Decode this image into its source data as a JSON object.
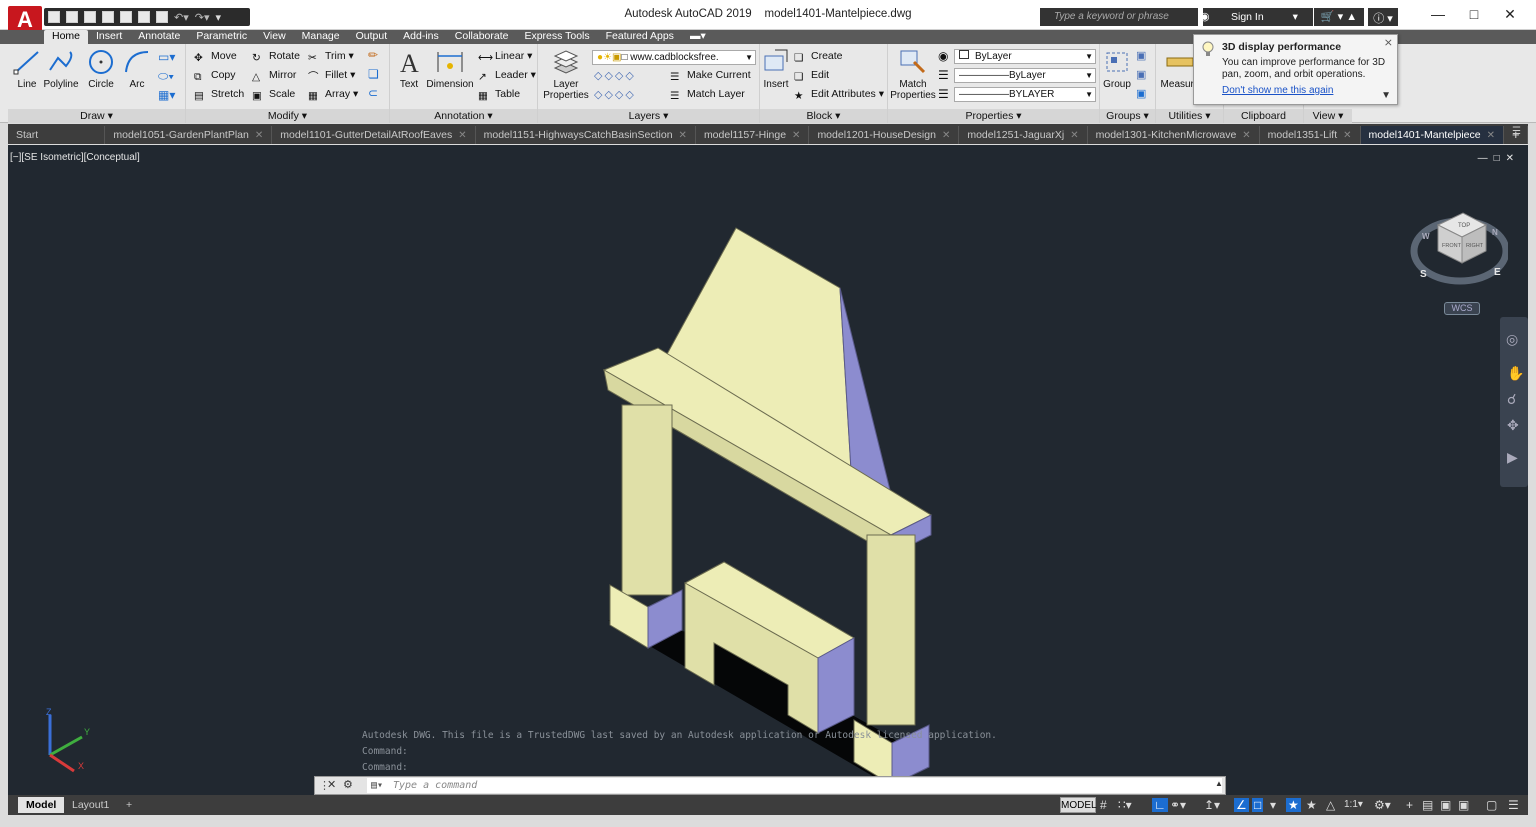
{
  "app": {
    "logo_letter": "A",
    "title": "Autodesk AutoCAD 2019",
    "filename": "model1401-Mantelpiece.dwg"
  },
  "search": {
    "placeholder": "Type a keyword or phrase"
  },
  "signin": {
    "label": "Sign In"
  },
  "ribbon_tabs": [
    "Home",
    "Insert",
    "Annotate",
    "Parametric",
    "View",
    "Manage",
    "Output",
    "Add-ins",
    "Collaborate",
    "Express Tools",
    "Featured Apps"
  ],
  "draw": {
    "line": "Line",
    "polyline": "Polyline",
    "circle": "Circle",
    "arc": "Arc",
    "title": "Draw"
  },
  "modify": {
    "move": "Move",
    "rotate": "Rotate",
    "trim": "Trim",
    "copy": "Copy",
    "mirror": "Mirror",
    "fillet": "Fillet",
    "stretch": "Stretch",
    "scale": "Scale",
    "array": "Array",
    "title": "Modify"
  },
  "annotation": {
    "text": "Text",
    "dimension": "Dimension",
    "linear": "Linear",
    "leader": "Leader",
    "table": "Table",
    "title": "Annotation"
  },
  "layers": {
    "layer_properties": "Layer Properties",
    "current_layer": "www.cadblocksfree.",
    "make_current": "Make Current",
    "match_layer": "Match Layer",
    "title": "Layers"
  },
  "block": {
    "insert": "Insert",
    "create": "Create",
    "edit": "Edit",
    "edit_attributes": "Edit Attributes",
    "title": "Block"
  },
  "properties": {
    "match_properties": "Match Properties",
    "color": "ByLayer",
    "linetype": "ByLayer",
    "lineweight": "BYLAYER",
    "title": "Properties"
  },
  "groups": {
    "group": "Group",
    "title": "Groups"
  },
  "utilities": {
    "measure": "Measure",
    "title": "Utilities"
  },
  "clipboard": {
    "title": "Clipboard"
  },
  "view": {
    "title": "View"
  },
  "tooltip": {
    "title": "3D display performance",
    "body": "You can improve performance for 3D pan, zoom, and orbit operations.",
    "link": "Don't show me this again"
  },
  "file_tabs": [
    {
      "label": "Start",
      "active": false
    },
    {
      "label": "model1051-GardenPlantPlan",
      "active": false
    },
    {
      "label": "model1101-GutterDetailAtRoofEaves",
      "active": false
    },
    {
      "label": "model1151-HighwaysCatchBasinSection",
      "active": false
    },
    {
      "label": "model1157-Hinge",
      "active": false
    },
    {
      "label": "model1201-HouseDesign",
      "active": false
    },
    {
      "label": "model1251-JaguarXj",
      "active": false
    },
    {
      "label": "model1301-KitchenMicrowave",
      "active": false
    },
    {
      "label": "model1351-Lift",
      "active": false
    },
    {
      "label": "model1401-Mantelpiece",
      "active": true
    }
  ],
  "viewport": {
    "label": "[−][SE Isometric][Conceptual]",
    "wcs": "WCS",
    "viewcube": {
      "top": "TOP",
      "front": "FRONT",
      "right": "RIGHT",
      "south": "S",
      "east": "E",
      "west": "W",
      "north": "N"
    }
  },
  "command": {
    "history": [
      "Autodesk DWG.  This file is a TrustedDWG last saved by an Autodesk application or Autodesk licensed application.",
      "Command:",
      "Command:"
    ],
    "placeholder": "Type a command"
  },
  "status": {
    "layout_tabs": [
      "Model",
      "Layout1"
    ],
    "model_label": "MODEL",
    "scale": "1:1"
  },
  "colors": {
    "ribbon_bg": "#e8e8e8",
    "viewport_bg": "#212830",
    "model_face": "#ededb6",
    "model_side": "#8c8ccf",
    "accent": "#1c6dd0"
  }
}
